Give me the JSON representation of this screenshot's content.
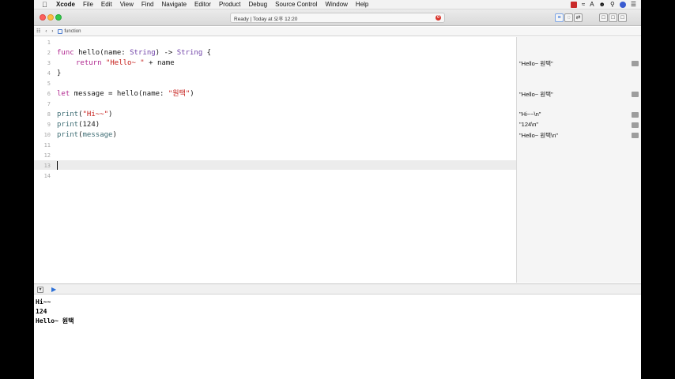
{
  "menubar": {
    "app": "Xcode",
    "items": [
      "File",
      "Edit",
      "View",
      "Find",
      "Navigate",
      "Editor",
      "Product",
      "Debug",
      "Source Control",
      "Window",
      "Help"
    ]
  },
  "toolbar": {
    "status_left": "Ready",
    "status_right": "Today at 오후 12:20",
    "error_count": "0"
  },
  "jumpbar": {
    "file": "function"
  },
  "editor": {
    "line_numbers": [
      "1",
      "2",
      "3",
      "4",
      "5",
      "6",
      "7",
      "8",
      "9",
      "10",
      "11",
      "12",
      "13",
      "14"
    ],
    "current_line": "13",
    "code": {
      "l2_kw": "func",
      "l2_a": " hello(name: ",
      "l2_type1": "String",
      "l2_b": ") -> ",
      "l2_type2": "String",
      "l2_c": " {",
      "l3_kw": "return",
      "l3_str": "\"Hello~ \"",
      "l3_rest": " + name",
      "l4": "}",
      "l6_kw": "let",
      "l6_a": " message = hello(name: ",
      "l6_str": "\"원택\"",
      "l6_b": ")",
      "l8_fn": "print",
      "l8_a": "(",
      "l8_str": "\"Hi~~\"",
      "l8_b": ")",
      "l9_fn": "print",
      "l9_a": "(124)",
      "l10_fn": "print",
      "l10_a": "(",
      "l10_var": "message",
      "l10_b": ")"
    }
  },
  "results": {
    "r3": "\"Hello~ 원택\"",
    "r6": "\"Hello~ 원택\"",
    "r8": "\"Hi~~\\n\"",
    "r9": "\"124\\n\"",
    "r10": "\"Hello~ 원택\\n\""
  },
  "console": {
    "lines": [
      "Hi~~",
      "124",
      "Hello~ 원택"
    ]
  }
}
